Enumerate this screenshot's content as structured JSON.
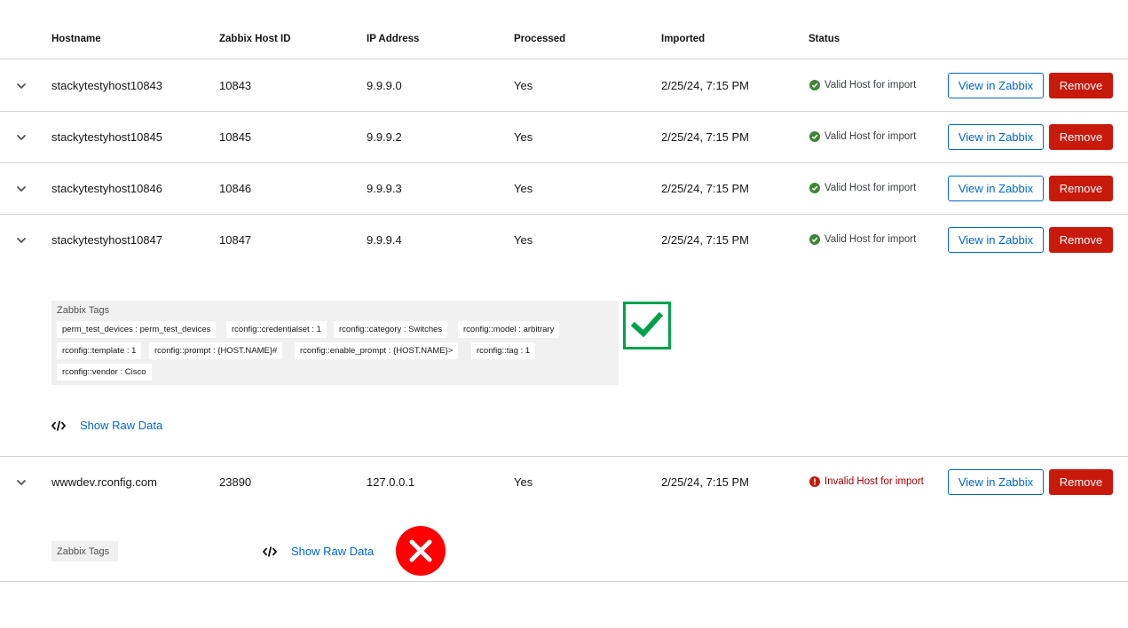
{
  "table": {
    "headers": {
      "hostname": "Hostname",
      "host_id": "Zabbix Host ID",
      "ip": "IP Address",
      "processed": "Processed",
      "imported": "Imported",
      "status": "Status"
    },
    "rows": [
      {
        "hostname": "stackytestyhost10843",
        "host_id": "10843",
        "ip": "9.9.9.0",
        "processed": "Yes",
        "imported": "2/25/24, 7:15 PM",
        "status": "Valid Host for import",
        "view_label": "View in Zabbix",
        "remove_label": "Remove"
      },
      {
        "hostname": "stackytestyhost10845",
        "host_id": "10845",
        "ip": "9.9.9.2",
        "processed": "Yes",
        "imported": "2/25/24, 7:15 PM",
        "status": "Valid Host for import",
        "view_label": "View in Zabbix",
        "remove_label": "Remove"
      },
      {
        "hostname": "stackytestyhost10846",
        "host_id": "10846",
        "ip": "9.9.9.3",
        "processed": "Yes",
        "imported": "2/25/24, 7:15 PM",
        "status": "Valid Host for import",
        "view_label": "View in Zabbix",
        "remove_label": "Remove"
      },
      {
        "hostname": "stackytestyhost10847",
        "host_id": "10847",
        "ip": "9.9.9.4",
        "processed": "Yes",
        "imported": "2/25/24, 7:15 PM",
        "status": "Valid Host for import",
        "view_label": "View in Zabbix",
        "remove_label": "Remove"
      },
      {
        "hostname": "wwwdev.rconfig.com",
        "host_id": "23890",
        "ip": "127.0.0.1",
        "processed": "Yes",
        "imported": "2/25/24, 7:15 PM",
        "status": "Invalid Host for import",
        "view_label": "View in Zabbix",
        "remove_label": "Remove"
      }
    ]
  },
  "expanded": {
    "tags_title": "Zabbix Tags",
    "tags": [
      "perm_test_devices : perm_test_devices",
      "rconfig::credentialset : 1",
      "rconfig::category : Switches",
      "rconfig::model : arbitrary",
      "rconfig::template : 1",
      "rconfig::prompt : {HOST.NAME}#",
      "rconfig::enable_prompt : {HOST.NAME}>",
      "rconfig::tag : 1",
      "rconfig::vendor : Cisco"
    ],
    "raw_data_label": "Show Raw Data"
  },
  "expanded_invalid": {
    "tags_title": "Zabbix Tags",
    "raw_data_label": "Show Raw Data"
  },
  "icons": {
    "toggle": "chevron-down-icon",
    "valid": "check-circle-icon",
    "invalid": "exclamation-circle-icon",
    "code": "code-icon",
    "overlay_valid": "checkmark-icon",
    "overlay_invalid": "x-icon"
  },
  "colors": {
    "primary": "#0066cc",
    "danger": "#c9190b",
    "success": "#3e8635",
    "error": "#a30000",
    "overlay_check": "#00a14b",
    "overlay_x": "#ff0000"
  }
}
